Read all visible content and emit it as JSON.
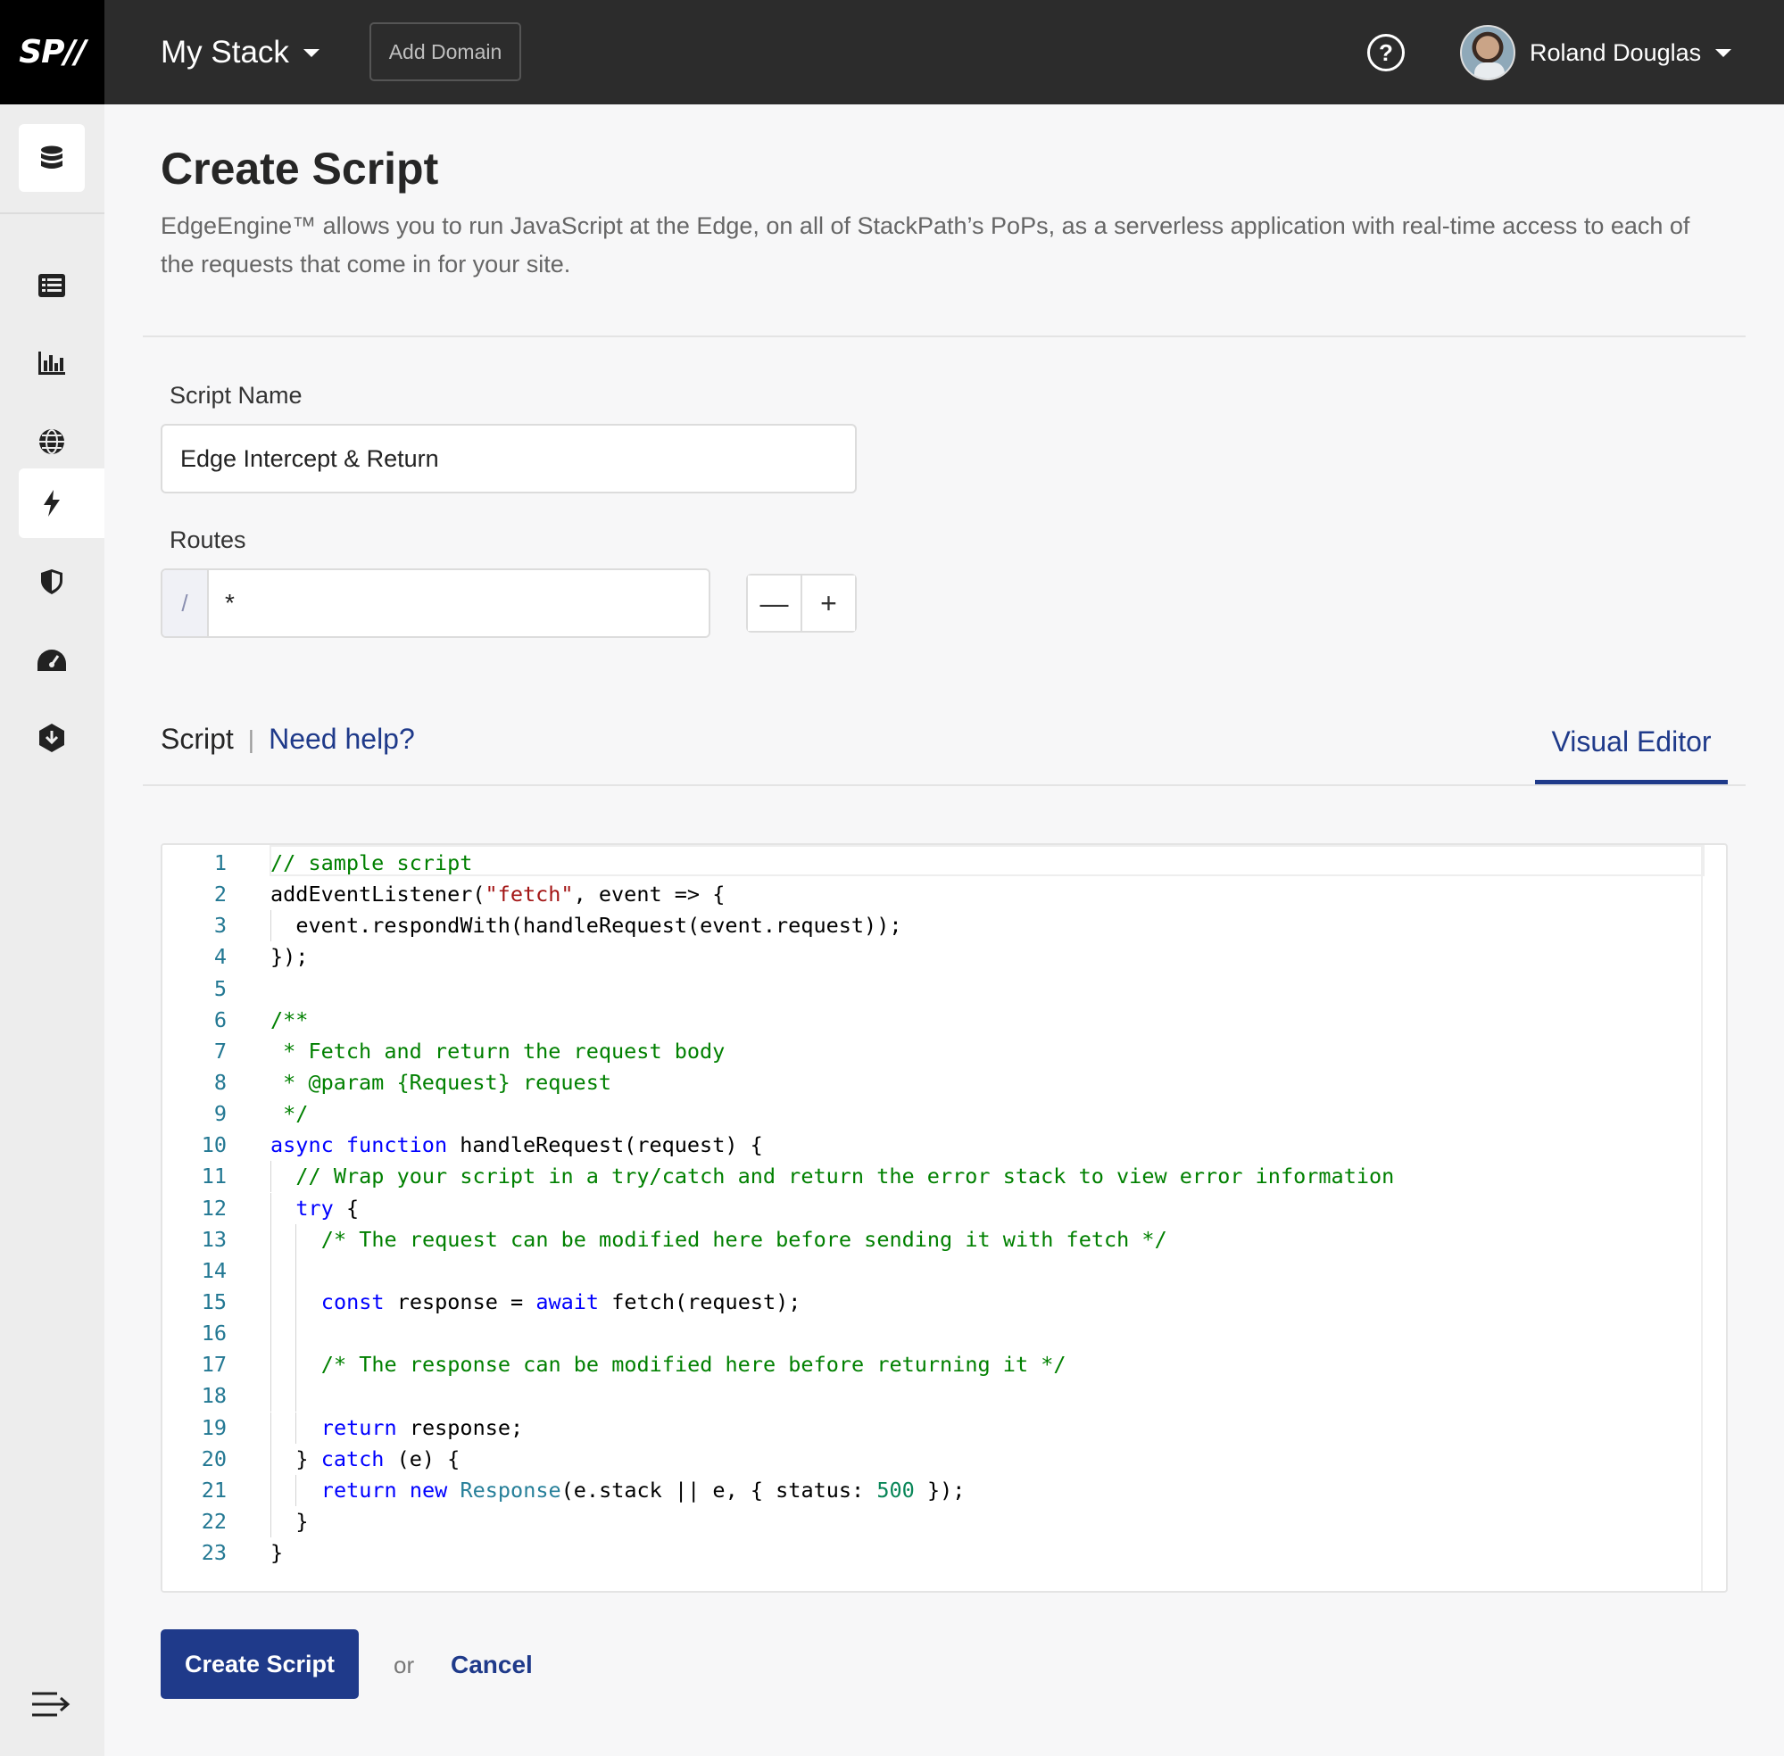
{
  "app": {
    "logo_text": "SP//",
    "stack_name": "My Stack",
    "add_domain_label": "Add Domain",
    "help_icon": "question-circle-icon",
    "user_name": "Roland Douglas"
  },
  "sidebar": {
    "items": [
      {
        "icon": "database-icon"
      },
      {
        "icon": "list-icon"
      },
      {
        "icon": "bar-chart-icon"
      },
      {
        "icon": "globe-icon"
      },
      {
        "icon": "lightning-icon",
        "active": true
      },
      {
        "icon": "shield-icon"
      },
      {
        "icon": "speedometer-icon"
      },
      {
        "icon": "download-hexagon-icon"
      }
    ],
    "collapse_icon": "collapse-menu-icon"
  },
  "page": {
    "title": "Create Script",
    "description": "EdgeEngine™ allows you to run JavaScript at the Edge, on all of StackPath’s PoPs, as a serverless application with real-time access to each of the requests that come in for your site."
  },
  "form": {
    "script_name_label": "Script Name",
    "script_name_value": "Edge Intercept & Return",
    "routes_label": "Routes",
    "route_prefix": "/",
    "route_value": "*",
    "remove_route_label": "—",
    "add_route_label": "+"
  },
  "script_section": {
    "label": "Script",
    "separator": "|",
    "help_link": "Need help?",
    "tab_label": "Visual Editor"
  },
  "editor": {
    "lines": [
      {
        "n": "1",
        "indent": 0,
        "tokens": [
          {
            "t": "// sample script",
            "c": "com"
          }
        ]
      },
      {
        "n": "2",
        "indent": 0,
        "tokens": [
          {
            "t": "addEventListener(",
            "c": ""
          },
          {
            "t": "\"fetch\"",
            "c": "str"
          },
          {
            "t": ", event => {",
            "c": ""
          }
        ]
      },
      {
        "n": "3",
        "indent": 1,
        "tokens": [
          {
            "t": "event.respondWith(handleRequest(event.request));",
            "c": ""
          }
        ]
      },
      {
        "n": "4",
        "indent": 0,
        "tokens": [
          {
            "t": "});",
            "c": ""
          }
        ]
      },
      {
        "n": "5",
        "indent": 0,
        "tokens": []
      },
      {
        "n": "6",
        "indent": 0,
        "tokens": [
          {
            "t": "/**",
            "c": "com"
          }
        ]
      },
      {
        "n": "7",
        "indent": 0,
        "tokens": [
          {
            "t": " * Fetch and return the request body",
            "c": "com"
          }
        ]
      },
      {
        "n": "8",
        "indent": 0,
        "tokens": [
          {
            "t": " * @param {Request} request",
            "c": "com"
          }
        ]
      },
      {
        "n": "9",
        "indent": 0,
        "tokens": [
          {
            "t": " */",
            "c": "com"
          }
        ]
      },
      {
        "n": "10",
        "indent": 0,
        "tokens": [
          {
            "t": "async",
            "c": "kw"
          },
          {
            "t": " ",
            "c": ""
          },
          {
            "t": "function",
            "c": "kw"
          },
          {
            "t": " handleRequest(request) {",
            "c": ""
          }
        ]
      },
      {
        "n": "11",
        "indent": 1,
        "tokens": [
          {
            "t": "// Wrap your script in a try/catch and return the error stack to view error information",
            "c": "com"
          }
        ]
      },
      {
        "n": "12",
        "indent": 1,
        "tokens": [
          {
            "t": "try",
            "c": "kw"
          },
          {
            "t": " {",
            "c": ""
          }
        ]
      },
      {
        "n": "13",
        "indent": 2,
        "tokens": [
          {
            "t": "/* The request can be modified here before sending it with fetch */",
            "c": "com"
          }
        ]
      },
      {
        "n": "14",
        "indent": 2,
        "tokens": []
      },
      {
        "n": "15",
        "indent": 2,
        "tokens": [
          {
            "t": "const",
            "c": "kw"
          },
          {
            "t": " response = ",
            "c": ""
          },
          {
            "t": "await",
            "c": "kw"
          },
          {
            "t": " fetch(request);",
            "c": ""
          }
        ]
      },
      {
        "n": "16",
        "indent": 2,
        "tokens": []
      },
      {
        "n": "17",
        "indent": 2,
        "tokens": [
          {
            "t": "/* The response can be modified here before returning it */",
            "c": "com"
          }
        ]
      },
      {
        "n": "18",
        "indent": 2,
        "tokens": []
      },
      {
        "n": "19",
        "indent": 2,
        "tokens": [
          {
            "t": "return",
            "c": "kw"
          },
          {
            "t": " response;",
            "c": ""
          }
        ]
      },
      {
        "n": "20",
        "indent": 1,
        "tokens": [
          {
            "t": "} ",
            "c": ""
          },
          {
            "t": "catch",
            "c": "kw"
          },
          {
            "t": " (e) {",
            "c": ""
          }
        ]
      },
      {
        "n": "21",
        "indent": 2,
        "tokens": [
          {
            "t": "return",
            "c": "kw"
          },
          {
            "t": " ",
            "c": ""
          },
          {
            "t": "new",
            "c": "kw"
          },
          {
            "t": " ",
            "c": ""
          },
          {
            "t": "Response",
            "c": "type"
          },
          {
            "t": "(e.stack || e, { status: ",
            "c": ""
          },
          {
            "t": "500",
            "c": "num"
          },
          {
            "t": " });",
            "c": ""
          }
        ]
      },
      {
        "n": "22",
        "indent": 1,
        "tokens": [
          {
            "t": "}",
            "c": ""
          }
        ]
      },
      {
        "n": "23",
        "indent": 0,
        "tokens": [
          {
            "t": "}",
            "c": ""
          }
        ]
      }
    ]
  },
  "actions": {
    "create_label": "Create Script",
    "or_text": "or",
    "cancel_label": "Cancel"
  },
  "colors": {
    "topbar": "#2c2c2c",
    "accent": "#1f3a8a",
    "comment": "#008000",
    "keyword": "#0000ff",
    "string": "#a31515"
  }
}
